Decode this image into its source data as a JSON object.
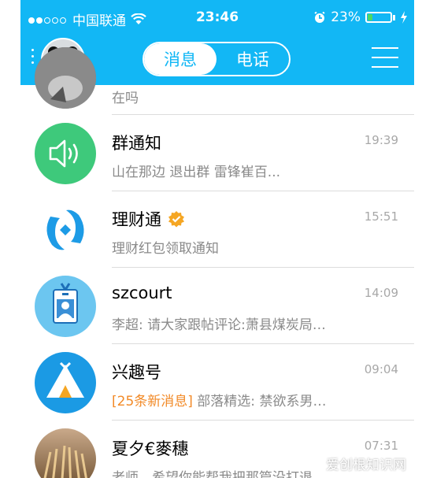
{
  "status_bar": {
    "carrier": "中国联通",
    "time": "23:46",
    "battery": "23%",
    "battery_level": 0.23
  },
  "nav": {
    "tab_messages": "消息",
    "tab_calls": "电话"
  },
  "partial_row": {
    "preview": "在吗"
  },
  "conversations": [
    {
      "name": "群通知",
      "time": "19:39",
      "preview": "山在那边 退出群 雷锋崔百...",
      "icon": "speaker-icon",
      "color": "#3ec97b"
    },
    {
      "name": "理财通",
      "time": "15:51",
      "preview": "理财红包领取通知",
      "icon": "licaitong-logo",
      "verified": true,
      "color": "#1d9be6"
    },
    {
      "name": "szcourt",
      "time": "14:09",
      "preview": "李超: 请大家跟帖评论:萧县煤炭局…",
      "icon": "id-badge-icon",
      "color": "#6cc6f0"
    },
    {
      "name": "兴趣号",
      "time": "09:04",
      "highlight": "[25条新消息]",
      "preview": " 部落精选: 禁欲系男…",
      "icon": "tent-icon",
      "color": "#1b9ae4"
    },
    {
      "name": "夏夕€麥穗",
      "time": "07:31",
      "preview": "老师，希望你能帮我把那篇没打退",
      "icon": "wheat-avatar",
      "color": "#a88a6a"
    }
  ],
  "watermark": "爱创根知识网"
}
